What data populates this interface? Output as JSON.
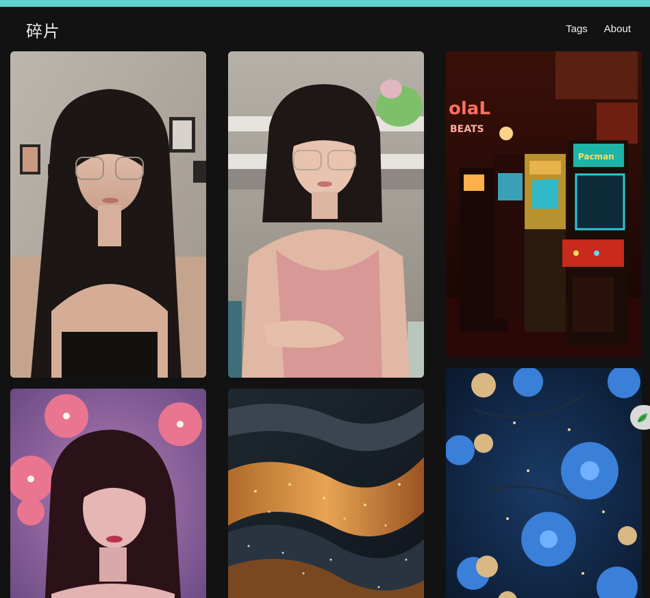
{
  "site": {
    "title": "碎片"
  },
  "nav": {
    "items": [
      "Tags",
      "About"
    ]
  },
  "gallery": {
    "cards": [
      {
        "subject": "girl-long-hair-glasses"
      },
      {
        "subject": "girl-pink-camisole-glasses"
      },
      {
        "subject": "arcade-cabinets"
      },
      {
        "subject": "girl-pink-flowers"
      },
      {
        "subject": "glitter-waves"
      },
      {
        "subject": "blue-flowers"
      }
    ]
  },
  "colors": {
    "accent_top_bar": "#5fd1cf",
    "background": "#121212",
    "side_tab": "#d9d9d9"
  },
  "icons": {
    "side_tab_icon": "leaf-icon"
  }
}
